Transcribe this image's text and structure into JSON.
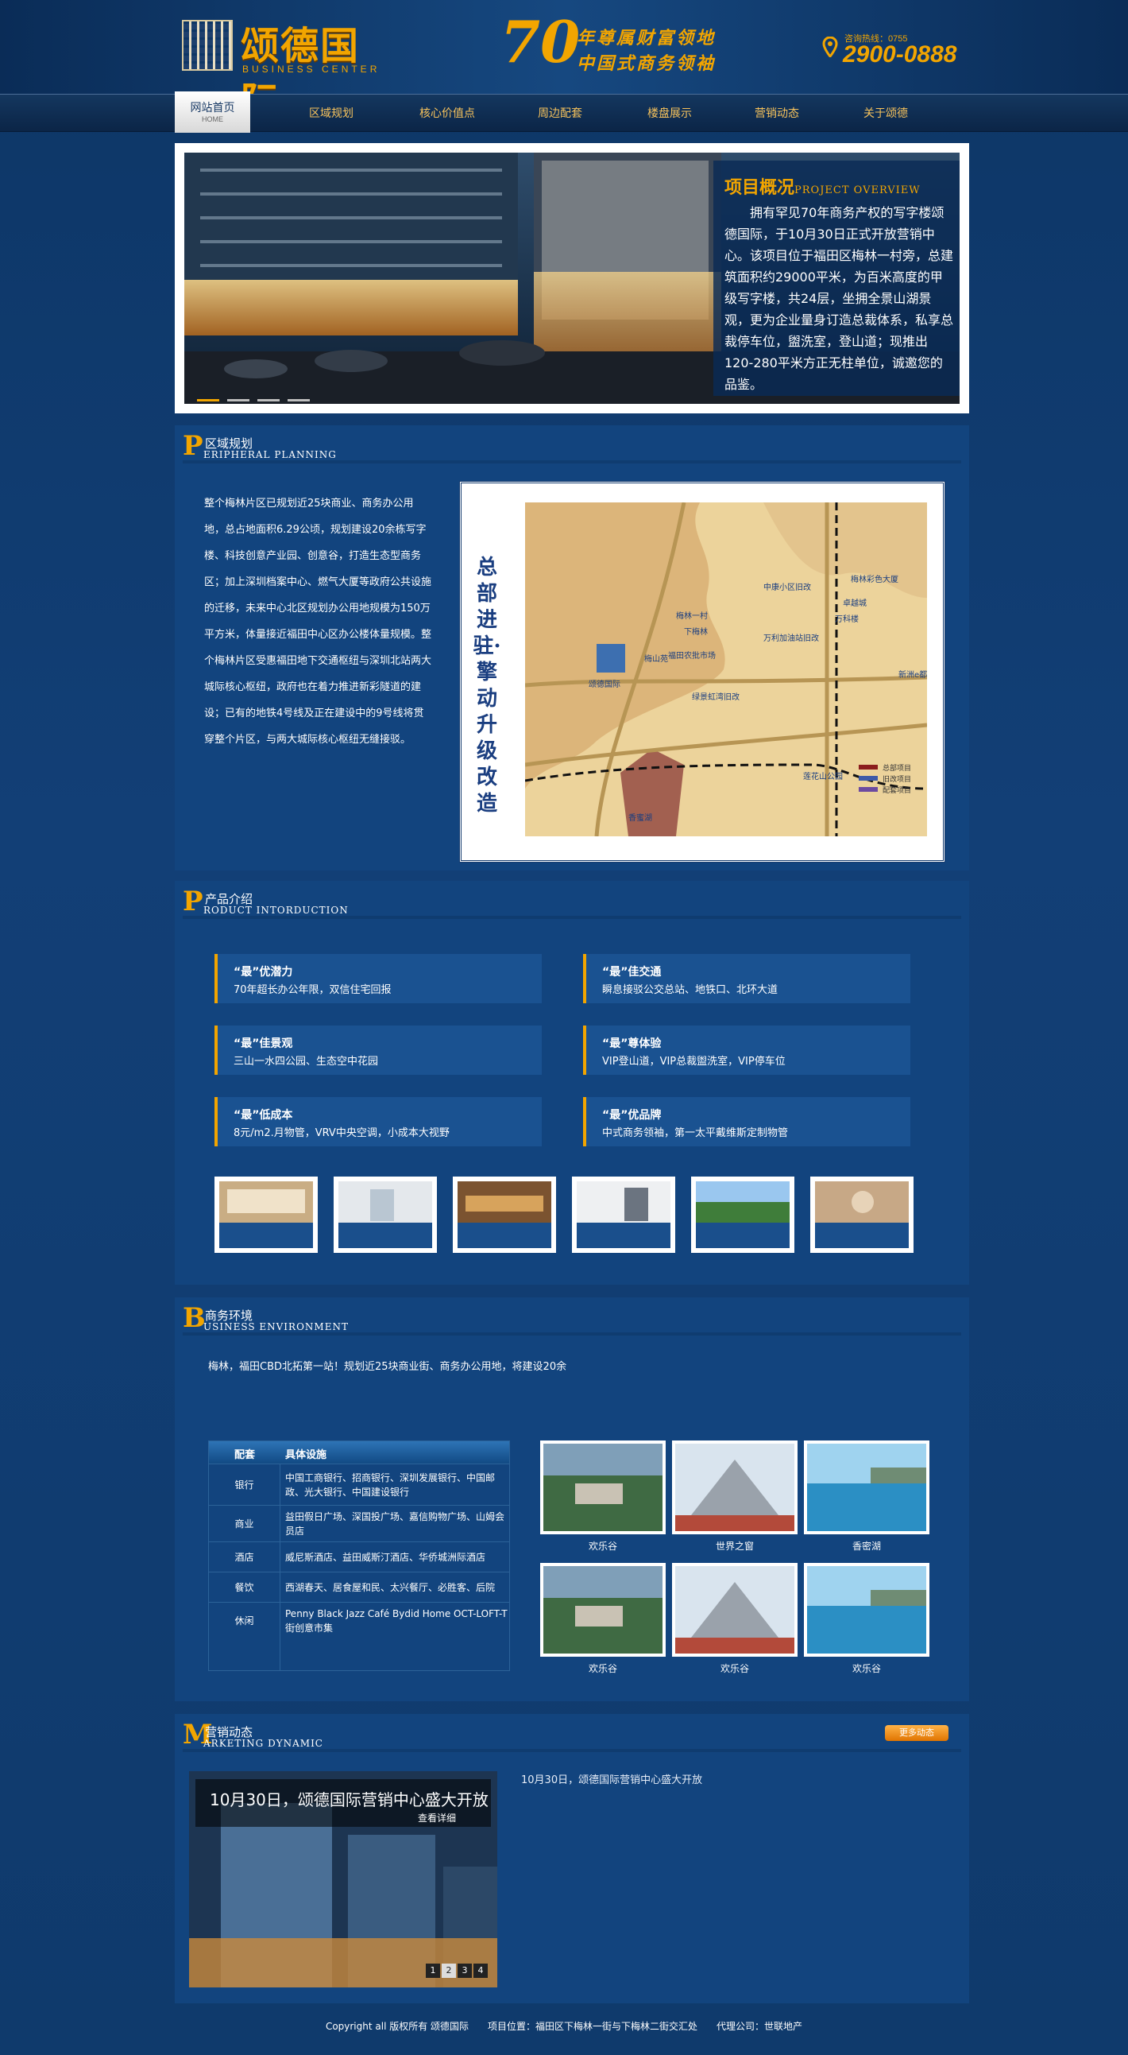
{
  "header": {
    "logo_name": "颂德国际",
    "logo_sub": "BUSINESS CENTER",
    "slogan_num": "70",
    "slogan_line1": "年尊属财富领地",
    "slogan_line2": "中国式商务领袖",
    "hotline_label": "咨询热线：0755",
    "hotline_num": "2900-0888"
  },
  "nav": {
    "home_cn": "网站首页",
    "home_en": "HOME",
    "items": [
      "区域规划",
      "核心价值点",
      "周边配套",
      "楼盘展示",
      "营销动态",
      "关于颂德"
    ]
  },
  "hero": {
    "title": "项目概况",
    "title_en": "PROJECT OVERVIEW",
    "body": "拥有罕见70年商务产权的写字楼颂德国际，于10月30日正式开放营销中心。该项目位于福田区梅林一村旁，总建筑面积约29000平米，为百米高度的甲级写字楼，共24层，坐拥全景山湖景观，更为企业量身订造总裁体系，私享总裁停车位，盥洗室，登山道；现推出120-280平米方正无柱单位，诚邀您的品鉴。",
    "slides": 4,
    "active_slide": 1
  },
  "planning": {
    "letter": "P",
    "cn": "区域规划",
    "en": "ERIPHERAL PLANNING",
    "text": "整个梅林片区已规划近25块商业、商务办公用地，总占地面积6.29公顷，规划建设20余栋写字楼、科技创意产业园、创意谷，打造生态型商务区；加上深圳档案中心、燃气大厦等政府公共设施的迁移，未来中心北区规划办公用地规模为150万平方米，体量接近福田中心区办公楼体量规模。整个梅林片区受惠福田地下交通枢纽与深圳北站两大城际核心枢纽，政府也在着力推进新彩隧道的建设；已有的地铁4号线及正在建设中的9号线将贯穿整个片区，与两大城际核心枢纽无缝接驳。",
    "map_title": "总部进驻·擎动升级改造",
    "map_labels": [
      "梅林一村",
      "下梅林",
      "梅山苑",
      "福田农批市场",
      "颂德国际",
      "绿景虹湾旧改",
      "中康小区旧改",
      "万利加油站旧改",
      "梅林彩色大厦",
      "新洲e都",
      "香蜜湖",
      "莲花山公园",
      "卓越城",
      "万科楼"
    ],
    "legend": [
      "总部项目",
      "旧改项目",
      "配套项目"
    ]
  },
  "product": {
    "letter": "P",
    "cn": "产品介绍",
    "en": "RODUCT INTORDUCTION",
    "features": [
      {
        "t": "“最”优潜力",
        "d": "70年超长办公年限，双信住宅回报"
      },
      {
        "t": "“最”佳交通",
        "d": "瞬息接驳公交总站、地铁口、北环大道"
      },
      {
        "t": "“最”佳景观",
        "d": "三山一水四公园、生态空中花园"
      },
      {
        "t": "“最”尊体验",
        "d": "VIP登山道，VIP总裁盥洗室，VIP停车位"
      },
      {
        "t": "“最”低成本",
        "d": "8元/m2.月物管，VRV中央空调，小成本大视野"
      },
      {
        "t": "“最”优品牌",
        "d": "中式商务领袖，第一太平戴维斯定制物管"
      }
    ]
  },
  "business": {
    "letter": "B",
    "cn": "商务环境",
    "en": "USINESS ENVIRONMENT",
    "intro": "梅林，福田CBD北拓第一站！规划近25块商业街、商务办公用地，将建设20余",
    "table_head": [
      "配套",
      "具体设施"
    ],
    "rows": [
      {
        "k": "银行",
        "v": "中国工商银行、招商银行、深圳发展银行、中国邮政、光大银行、中国建设银行"
      },
      {
        "k": "商业",
        "v": "益田假日广场、深国投广场、嘉信购物广场、山姆会员店"
      },
      {
        "k": "酒店",
        "v": "威尼斯酒店、益田威斯汀酒店、华侨城洲际酒店"
      },
      {
        "k": "餐饮",
        "v": "西湖春天、居食屋和民、太兴餐厅、必胜客、后院"
      },
      {
        "k": "休闲",
        "v": "Penny Black Jazz Café Bydid Home OCT-LOFT-T街创意市集"
      }
    ],
    "photos": [
      "欢乐谷",
      "世界之窗",
      "香密湖",
      "欢乐谷",
      "欢乐谷",
      "欢乐谷"
    ]
  },
  "marketing": {
    "letter": "M",
    "cn": "营销动态",
    "en": "ARKETING DYNAMIC",
    "more": "更多动态",
    "news_title": "10月30日，颂德国际营销中心盛大开放",
    "news_more": "查看详细",
    "pages": [
      "1",
      "2",
      "3",
      "4"
    ],
    "active_page": "2",
    "item": "10月30日，颂德国际营销中心盛大开放"
  },
  "footer": {
    "text": "Copyright all 版权所有 颂德国际　　项目位置：福田区下梅林一街与下梅林二街交汇处　　代理公司：世联地产"
  },
  "colors": {
    "gold": "#f2a500",
    "navy": "#12447e",
    "bg": "#0f3a6e"
  }
}
